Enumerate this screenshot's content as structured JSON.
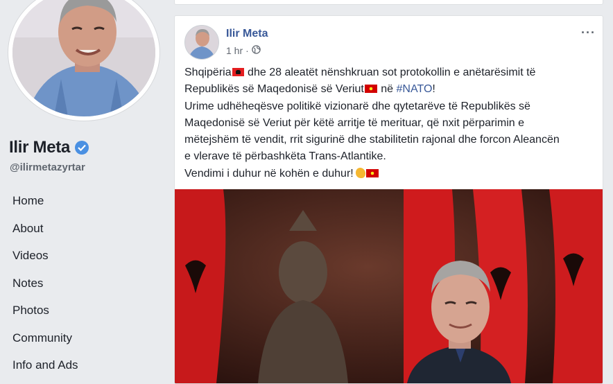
{
  "page": {
    "name": "Ilir Meta",
    "handle": "@ilirmetazyrtar"
  },
  "nav": {
    "items": [
      {
        "label": "Home"
      },
      {
        "label": "About"
      },
      {
        "label": "Videos"
      },
      {
        "label": "Notes"
      },
      {
        "label": "Photos"
      },
      {
        "label": "Community"
      },
      {
        "label": "Info and Ads"
      }
    ]
  },
  "post": {
    "author": "Ilir Meta",
    "time": "1 hr",
    "dot": "·",
    "more": "···",
    "text": {
      "l1_a": "Shqipëria",
      "l1_b": " dhe 28 aleatët nënshkruan sot protokollin e anëtarësimit të",
      "l2_a": "Republikës së Maqedonisë së Veriut",
      "l2_b": " në ",
      "hashtag": "#NATO",
      "l2_c": "!",
      "l3": "Urime udhëheqësve politikë vizionarë dhe qytetarëve të Republikës së",
      "l4": "Maqedonisë së Veriut për këtë arritje të merituar, që nxit përparimin e",
      "l5": "mëtejshëm të vendit, rrit sigurinë dhe stabilitetin rajonal dhe forcon Aleancën",
      "l6": "e vlerave të përbashkëta Trans-Atlantike.",
      "l7": "Vendimi i duhur në kohën e duhur!"
    }
  },
  "icons": {
    "verified": "verified-badge-icon",
    "globe": "globe-icon",
    "more": "more-options-icon"
  },
  "colors": {
    "link": "#385898",
    "verified": "#4a90e2",
    "background": "#e9ebee"
  }
}
